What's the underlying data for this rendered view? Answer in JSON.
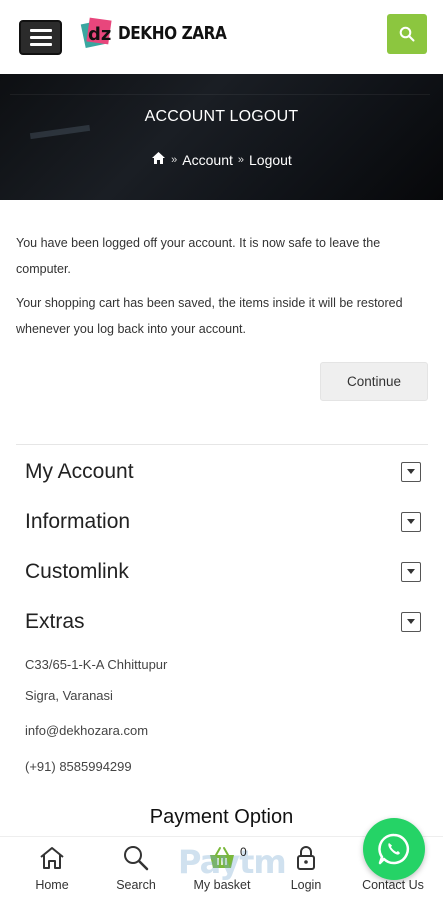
{
  "header": {
    "logo_text": "DEKHO ZARA",
    "logo_mark": "dz"
  },
  "banner": {
    "title": "ACCOUNT LOGOUT",
    "breadcrumbs": [
      "Account",
      "Logout"
    ]
  },
  "content": {
    "paragraph1": "You have been logged off your account. It is now safe to leave the computer.",
    "paragraph2": "Your shopping cart has been saved, the items inside it will be restored whenever you log back into your account.",
    "continue_label": "Continue"
  },
  "footer": {
    "sections": [
      "My Account",
      "Information",
      "Customlink",
      "Extras"
    ],
    "address_line1": "C33/65-1-K-A Chhittupur",
    "address_line2": "Sigra, Varanasi",
    "email": "info@dekhozara.com",
    "phone": "(+91) 8585994299",
    "payment_title": "Payment Option",
    "paytm_text": "Paytm"
  },
  "bottom_nav": {
    "items": [
      "Home",
      "Search",
      "My basket",
      "Login",
      "Contact Us"
    ],
    "basket_count": "0"
  },
  "colors": {
    "accent_green": "#8cc63f",
    "whatsapp_green": "#25d366",
    "banner_dark": "#101318"
  },
  "icons": [
    "menu-icon",
    "search-icon",
    "home-icon",
    "chevron-right-icon",
    "chevron-down-icon",
    "basket-icon",
    "lock-icon",
    "whatsapp-icon"
  ]
}
